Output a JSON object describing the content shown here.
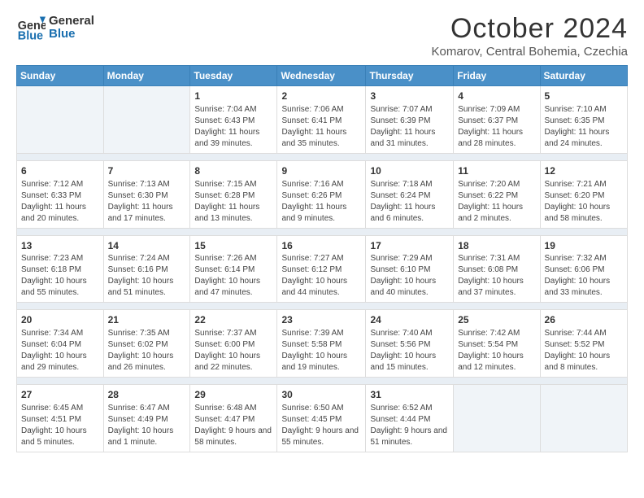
{
  "header": {
    "logo_line1": "General",
    "logo_line2": "Blue",
    "month": "October 2024",
    "location": "Komarov, Central Bohemia, Czechia"
  },
  "days_of_week": [
    "Sunday",
    "Monday",
    "Tuesday",
    "Wednesday",
    "Thursday",
    "Friday",
    "Saturday"
  ],
  "weeks": [
    [
      {
        "day": "",
        "info": ""
      },
      {
        "day": "",
        "info": ""
      },
      {
        "day": "1",
        "info": "Sunrise: 7:04 AM\nSunset: 6:43 PM\nDaylight: 11 hours and 39 minutes."
      },
      {
        "day": "2",
        "info": "Sunrise: 7:06 AM\nSunset: 6:41 PM\nDaylight: 11 hours and 35 minutes."
      },
      {
        "day": "3",
        "info": "Sunrise: 7:07 AM\nSunset: 6:39 PM\nDaylight: 11 hours and 31 minutes."
      },
      {
        "day": "4",
        "info": "Sunrise: 7:09 AM\nSunset: 6:37 PM\nDaylight: 11 hours and 28 minutes."
      },
      {
        "day": "5",
        "info": "Sunrise: 7:10 AM\nSunset: 6:35 PM\nDaylight: 11 hours and 24 minutes."
      }
    ],
    [
      {
        "day": "6",
        "info": "Sunrise: 7:12 AM\nSunset: 6:33 PM\nDaylight: 11 hours and 20 minutes."
      },
      {
        "day": "7",
        "info": "Sunrise: 7:13 AM\nSunset: 6:30 PM\nDaylight: 11 hours and 17 minutes."
      },
      {
        "day": "8",
        "info": "Sunrise: 7:15 AM\nSunset: 6:28 PM\nDaylight: 11 hours and 13 minutes."
      },
      {
        "day": "9",
        "info": "Sunrise: 7:16 AM\nSunset: 6:26 PM\nDaylight: 11 hours and 9 minutes."
      },
      {
        "day": "10",
        "info": "Sunrise: 7:18 AM\nSunset: 6:24 PM\nDaylight: 11 hours and 6 minutes."
      },
      {
        "day": "11",
        "info": "Sunrise: 7:20 AM\nSunset: 6:22 PM\nDaylight: 11 hours and 2 minutes."
      },
      {
        "day": "12",
        "info": "Sunrise: 7:21 AM\nSunset: 6:20 PM\nDaylight: 10 hours and 58 minutes."
      }
    ],
    [
      {
        "day": "13",
        "info": "Sunrise: 7:23 AM\nSunset: 6:18 PM\nDaylight: 10 hours and 55 minutes."
      },
      {
        "day": "14",
        "info": "Sunrise: 7:24 AM\nSunset: 6:16 PM\nDaylight: 10 hours and 51 minutes."
      },
      {
        "day": "15",
        "info": "Sunrise: 7:26 AM\nSunset: 6:14 PM\nDaylight: 10 hours and 47 minutes."
      },
      {
        "day": "16",
        "info": "Sunrise: 7:27 AM\nSunset: 6:12 PM\nDaylight: 10 hours and 44 minutes."
      },
      {
        "day": "17",
        "info": "Sunrise: 7:29 AM\nSunset: 6:10 PM\nDaylight: 10 hours and 40 minutes."
      },
      {
        "day": "18",
        "info": "Sunrise: 7:31 AM\nSunset: 6:08 PM\nDaylight: 10 hours and 37 minutes."
      },
      {
        "day": "19",
        "info": "Sunrise: 7:32 AM\nSunset: 6:06 PM\nDaylight: 10 hours and 33 minutes."
      }
    ],
    [
      {
        "day": "20",
        "info": "Sunrise: 7:34 AM\nSunset: 6:04 PM\nDaylight: 10 hours and 29 minutes."
      },
      {
        "day": "21",
        "info": "Sunrise: 7:35 AM\nSunset: 6:02 PM\nDaylight: 10 hours and 26 minutes."
      },
      {
        "day": "22",
        "info": "Sunrise: 7:37 AM\nSunset: 6:00 PM\nDaylight: 10 hours and 22 minutes."
      },
      {
        "day": "23",
        "info": "Sunrise: 7:39 AM\nSunset: 5:58 PM\nDaylight: 10 hours and 19 minutes."
      },
      {
        "day": "24",
        "info": "Sunrise: 7:40 AM\nSunset: 5:56 PM\nDaylight: 10 hours and 15 minutes."
      },
      {
        "day": "25",
        "info": "Sunrise: 7:42 AM\nSunset: 5:54 PM\nDaylight: 10 hours and 12 minutes."
      },
      {
        "day": "26",
        "info": "Sunrise: 7:44 AM\nSunset: 5:52 PM\nDaylight: 10 hours and 8 minutes."
      }
    ],
    [
      {
        "day": "27",
        "info": "Sunrise: 6:45 AM\nSunset: 4:51 PM\nDaylight: 10 hours and 5 minutes."
      },
      {
        "day": "28",
        "info": "Sunrise: 6:47 AM\nSunset: 4:49 PM\nDaylight: 10 hours and 1 minute."
      },
      {
        "day": "29",
        "info": "Sunrise: 6:48 AM\nSunset: 4:47 PM\nDaylight: 9 hours and 58 minutes."
      },
      {
        "day": "30",
        "info": "Sunrise: 6:50 AM\nSunset: 4:45 PM\nDaylight: 9 hours and 55 minutes."
      },
      {
        "day": "31",
        "info": "Sunrise: 6:52 AM\nSunset: 4:44 PM\nDaylight: 9 hours and 51 minutes."
      },
      {
        "day": "",
        "info": ""
      },
      {
        "day": "",
        "info": ""
      }
    ]
  ]
}
